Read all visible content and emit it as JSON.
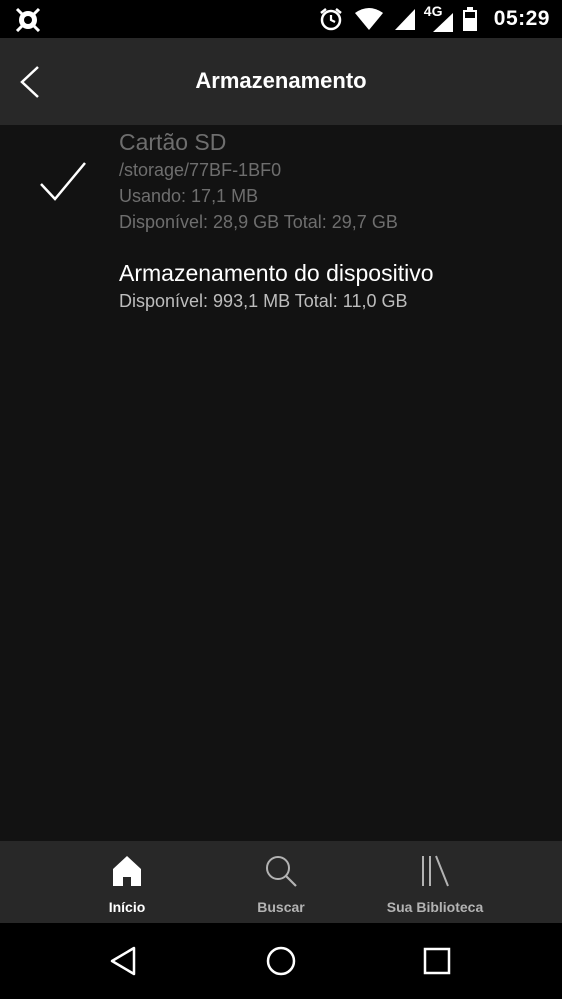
{
  "status_bar": {
    "time": "05:29",
    "network": "4G",
    "icons": [
      "app-notification-icon",
      "alarm-icon",
      "wifi-icon",
      "signal-icon",
      "signal-icon",
      "battery-icon"
    ]
  },
  "header": {
    "title": "Armazenamento",
    "back_icon": "back-arrow-icon"
  },
  "storage_options": [
    {
      "name": "Cartão SD",
      "path": "/storage/77BF-1BF0",
      "usage": "Usando: 17,1 MB",
      "space": "Disponível: 28,9 GB Total: 29,7 GB",
      "selected": true
    },
    {
      "name": "Armazenamento do dispositivo",
      "space": "Disponível: 993,1 MB Total: 11,0 GB",
      "selected": false
    }
  ],
  "bottom_nav": [
    {
      "label": "Início",
      "icon": "home-icon",
      "active": true
    },
    {
      "label": "Buscar",
      "icon": "search-icon",
      "active": false
    },
    {
      "label": "Sua Biblioteca",
      "icon": "library-icon",
      "active": false
    }
  ],
  "system_nav": [
    "back-triangle-icon",
    "home-circle-icon",
    "recents-square-icon"
  ],
  "colors": {
    "background": "#121212",
    "header": "#282828",
    "disabled_text": "#6e6e6e",
    "secondary_text": "#bdbdbd"
  }
}
